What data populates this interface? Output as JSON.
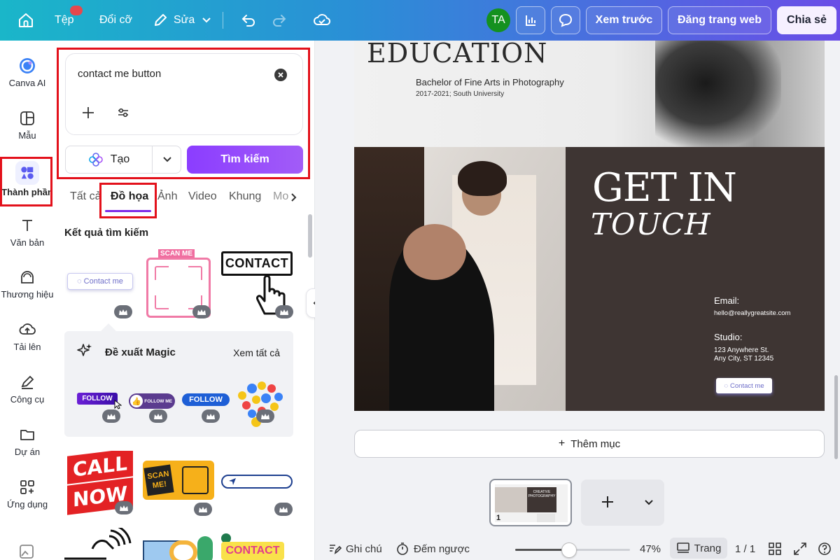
{
  "topbar": {
    "file": "Tệp",
    "file_badge": "",
    "resize": "Đổi cỡ",
    "edit": "Sửa",
    "avatar": "TA",
    "preview": "Xem trước",
    "publish": "Đăng trang web",
    "share": "Chia sẻ",
    "colors": {
      "avatar": "#14911f"
    }
  },
  "sidebar": {
    "items": [
      {
        "label": "Canva AI",
        "icon": "canva-ai-icon"
      },
      {
        "label": "Mẫu",
        "icon": "template-icon"
      },
      {
        "label": "Thành phần",
        "icon": "elements-icon"
      },
      {
        "label": "Văn bản",
        "icon": "text-icon"
      },
      {
        "label": "Thương hiệu",
        "icon": "brand-icon"
      },
      {
        "label": "Tải lên",
        "icon": "upload-icon"
      },
      {
        "label": "Công cụ",
        "icon": "tools-icon"
      },
      {
        "label": "Dự án",
        "icon": "folder-icon"
      },
      {
        "label": "Ứng dụng",
        "icon": "apps-icon"
      }
    ]
  },
  "panel": {
    "search_value": "contact me button",
    "create_label": "Tạo",
    "search_button": "Tìm kiếm",
    "tabs": [
      "Tất cả",
      "Đồ họa",
      "Ảnh",
      "Video",
      "Khung",
      "Mo"
    ],
    "active_tab": "Đồ họa",
    "results_title": "Kết quả tìm kiếm",
    "magic_title": "Đề xuất Magic",
    "see_all": "Xem tất cả",
    "graphics": {
      "contact_pill": "Contact me",
      "scan_me": "SCAN ME",
      "contact_big": "CONTACT",
      "follow1": "FOLLOW",
      "follow_me": "FOLLOW ME",
      "follow3": "FOLLOW",
      "call": "CALL",
      "now": "NOW",
      "scan_me2a": "SCAN",
      "scan_me2b": "ME!",
      "contact_bottom": "CONTACT"
    }
  },
  "canvas": {
    "education": "EDUCATION",
    "degree": "Bachelor of Fine Arts in Photography",
    "years": "2017-2021; South University",
    "get_in": "GET IN",
    "touch": "TOUCH",
    "email_label": "Email:",
    "email": "hello@reallygreatsite.com",
    "studio_label": "Studio:",
    "address1": "123 Anywhere St.",
    "address2": "Any City, ST 12345",
    "contact_button": "Contact me",
    "add_section": "Thêm mục",
    "page_number": "1",
    "thumb_title_a": "CREATIVE",
    "thumb_title_b": "PHOTOGRAPHY"
  },
  "bottombar": {
    "notes": "Ghi chú",
    "timer": "Đếm ngược",
    "zoom": "47%",
    "zoom_level": 0.47,
    "pages": "Trang",
    "page_count": "1 / 1"
  }
}
